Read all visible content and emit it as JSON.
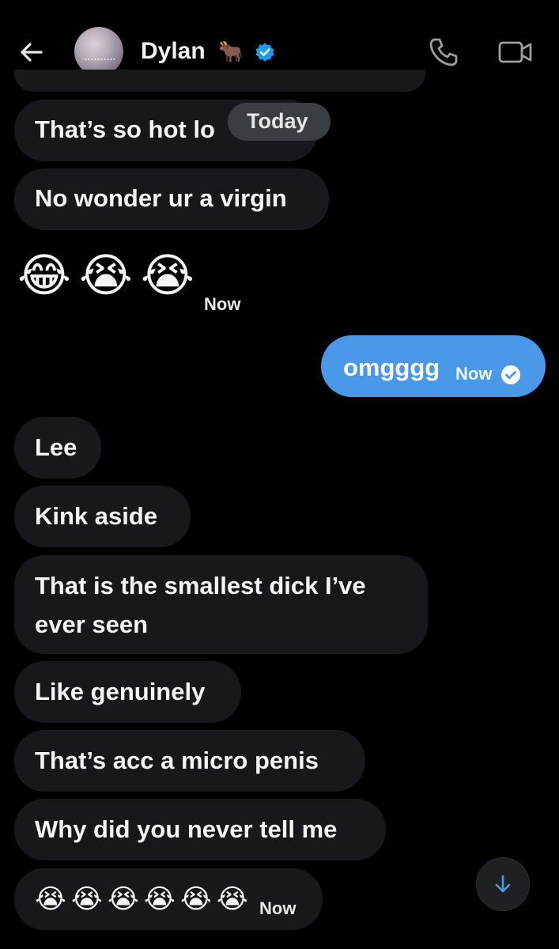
{
  "header": {
    "contact_name": "Dylan",
    "name_emoji": "🐂",
    "verified_badge_color": "#1d9bf0",
    "icons": [
      "back-arrow-icon",
      "avatar",
      "verified-badge-icon",
      "phone-icon",
      "video-camera-icon"
    ]
  },
  "date_separator": "Today",
  "messages": [
    {
      "from": "contact",
      "text": "That’s so hot lo"
    },
    {
      "from": "contact",
      "text": "No wonder ur a virgin"
    },
    {
      "from": "contact",
      "text": "😂😭😭",
      "time": "Now"
    },
    {
      "from": "me",
      "text": "omgggg",
      "time": "Now",
      "status": "read"
    },
    {
      "from": "contact",
      "text": "Lee"
    },
    {
      "from": "contact",
      "text": "Kink aside"
    },
    {
      "from": "contact",
      "text_line1": "That is the smallest dick I’ve",
      "text_line2": "ever seen"
    },
    {
      "from": "contact",
      "text": "Like genuinely"
    },
    {
      "from": "contact",
      "text": "That’s acc a micro penis"
    },
    {
      "from": "contact",
      "text": "Why did you never tell me"
    },
    {
      "from": "contact",
      "text": "😭😭😭😭😭😭",
      "time": "Now"
    }
  ],
  "emojis_1": [
    "😂",
    "😭",
    "😭"
  ],
  "emojis_2": [
    "😭",
    "😭",
    "😭",
    "😭",
    "😭",
    "😭"
  ],
  "colors": {
    "background": "#000000",
    "received_bubble": "#16181c",
    "sent_bubble": "#4a99e9",
    "text": "#f5f5f5"
  }
}
